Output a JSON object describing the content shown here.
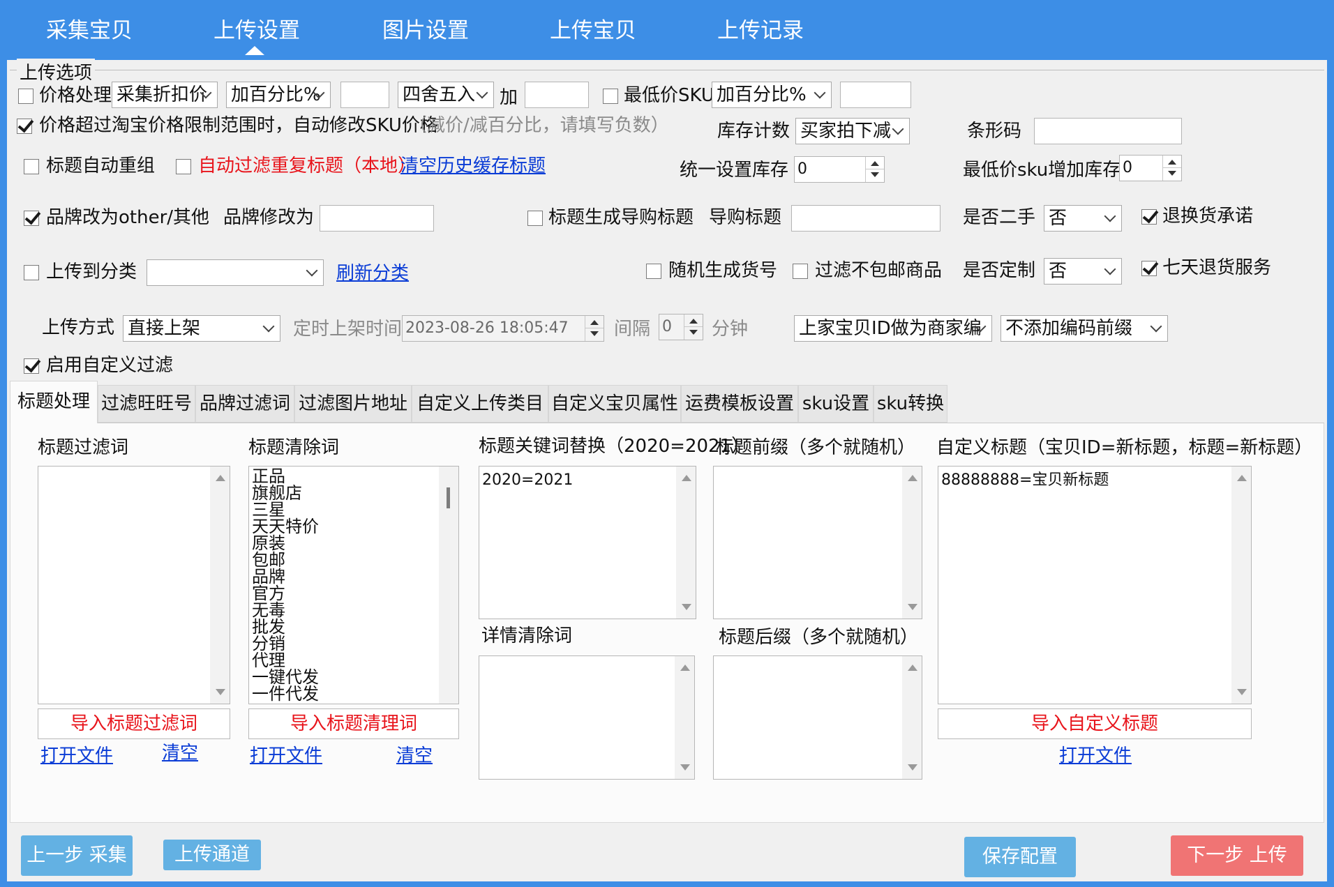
{
  "nav": {
    "tabs": [
      "采集宝贝",
      "上传设置",
      "图片设置",
      "上传宝贝",
      "上传记录"
    ]
  },
  "options": {
    "group_title": "上传选项",
    "price_process": {
      "label": "价格处理",
      "checked": false,
      "mode": "采集折扣价",
      "method": "加百分比%",
      "value": "",
      "round": "四舍五入",
      "add_label": "加",
      "add_value": ""
    },
    "lowest_sku": {
      "label": "最低价SKU",
      "checked": false,
      "method": "加百分比%",
      "value": ""
    },
    "auto_fix_price": {
      "label": "价格超过淘宝价格限制范围时，自动修改SKU价格",
      "checked": true,
      "hint": "（减价/减百分比，请填写负数）"
    },
    "stock_count": {
      "label": "库存计数",
      "value": "买家拍下减"
    },
    "barcode": {
      "label": "条形码",
      "value": ""
    },
    "title_regroup": {
      "label": "标题自动重组",
      "checked": false
    },
    "filter_dup_title": {
      "label": "自动过滤重复标题（本地）",
      "checked": false
    },
    "clear_cache_link": "清空历史缓存标题",
    "unified_stock": {
      "label": "统一设置库存",
      "value": "0"
    },
    "lowest_sku_stock": {
      "label": "最低价sku增加库存",
      "value": "0"
    },
    "brand_other": {
      "label": "品牌改为other/其他",
      "checked": true
    },
    "brand_modify": {
      "label": "品牌修改为",
      "value": ""
    },
    "gen_guide_title": {
      "label": "标题生成导购标题",
      "checked": false
    },
    "guide_title": {
      "label": "导购标题",
      "value": ""
    },
    "second_hand": {
      "label": "是否二手",
      "value": "否"
    },
    "return_promise": {
      "label": "退换货承诺",
      "checked": true
    },
    "upload_category": {
      "label": "上传到分类",
      "checked": false,
      "value": ""
    },
    "refresh_category_link": "刷新分类",
    "random_sku_no": {
      "label": "随机生成货号",
      "checked": false
    },
    "filter_no_free_ship": {
      "label": "过滤不包邮商品",
      "checked": false
    },
    "customized": {
      "label": "是否定制",
      "value": "否"
    },
    "seven_day_return": {
      "label": "七天退货服务",
      "checked": true
    },
    "upload_method": {
      "label": "上传方式",
      "value": "直接上架"
    },
    "scheduled_time": {
      "label": "定时上架时间",
      "value": "2023-08-26 18:05:47"
    },
    "interval": {
      "label": "间隔",
      "value": "0",
      "unit": "分钟"
    },
    "merchant_code": "上家宝贝ID做为商家编",
    "code_prefix": "不添加编码前缀",
    "custom_filter": {
      "label": "启用自定义过滤",
      "checked": true
    }
  },
  "tabs": [
    "标题处理",
    "过滤旺旺号",
    "品牌过滤词",
    "过滤图片地址",
    "自定义上传类目",
    "自定义宝贝属性",
    "运费模板设置",
    "sku设置",
    "sku转换"
  ],
  "title_tab": {
    "filter_words": {
      "label": "标题过滤词",
      "content": "",
      "import_button": "导入标题过滤词",
      "open_link": "打开文件",
      "clear_link": "清空"
    },
    "clear_words": {
      "label": "标题清除词",
      "content": "正品\n旗舰店\n三星\n天天特价\n原装\n包邮\n品牌\n官方\n无毒\n批发\n分销\n代理\n一键代发\n一件代发",
      "import_button": "导入标题清理词",
      "open_link": "打开文件",
      "clear_link": "清空"
    },
    "keyword_replace": {
      "label": "标题关键词替换（2020=2021）",
      "content": "2020=2021"
    },
    "detail_clear": {
      "label": "详情清除词",
      "content": ""
    },
    "prefix": {
      "label": "标题前缀（多个就随机）",
      "content": ""
    },
    "suffix": {
      "label": "标题后缀（多个就随机）",
      "content": ""
    },
    "custom_title": {
      "label": "自定义标题（宝贝ID=新标题，标题=新标题）",
      "content": "88888888=宝贝新标题",
      "import_button": "导入自定义标题",
      "open_link": "打开文件"
    }
  },
  "footer": {
    "prev_button": "上一步 采集",
    "channel_button": "上传通道",
    "save_button": "保存配置",
    "next_button": "下一步 上传"
  },
  "colors": {
    "nav_bg": "#3d8ee6",
    "button_blue": "#63b1e3",
    "button_red": "#f07474",
    "link": "#0a3cd6",
    "red_text": "#e8141b"
  }
}
